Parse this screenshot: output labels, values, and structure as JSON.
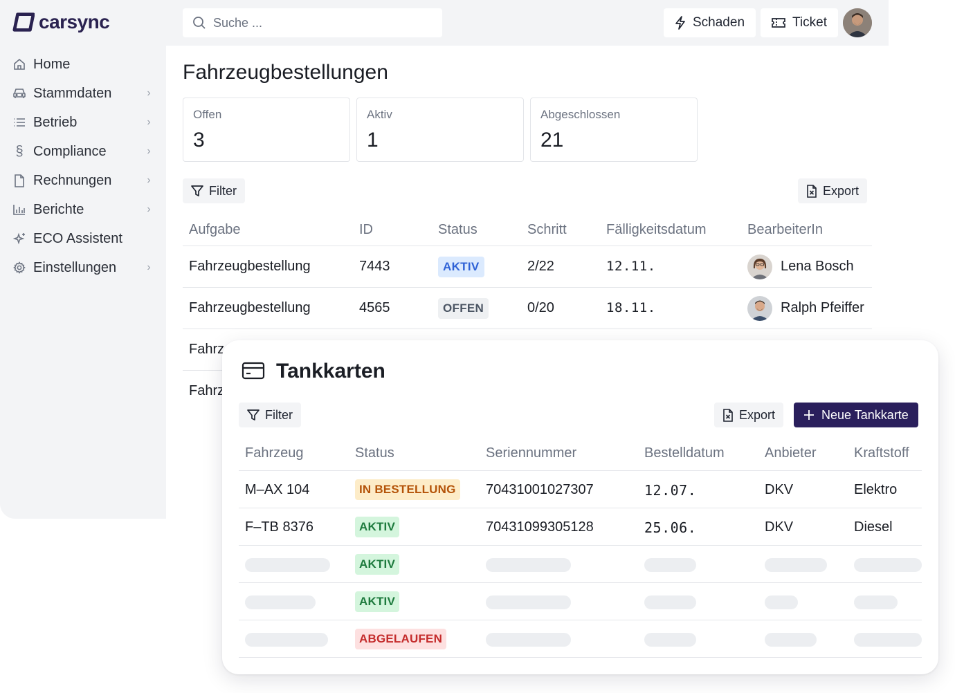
{
  "brand": {
    "name": "carsync",
    "color": "#2a2250"
  },
  "sidebar": {
    "items": [
      {
        "label": "Home",
        "icon": "home-icon",
        "chevron": false
      },
      {
        "label": "Stammdaten",
        "icon": "car-icon",
        "chevron": true
      },
      {
        "label": "Betrieb",
        "icon": "list-icon",
        "chevron": true
      },
      {
        "label": "Compliance",
        "icon": "section-icon",
        "chevron": true
      },
      {
        "label": "Rechnungen",
        "icon": "file-icon",
        "chevron": true
      },
      {
        "label": "Berichte",
        "icon": "bar-chart-icon",
        "chevron": true
      },
      {
        "label": "ECO Assistent",
        "icon": "sparkles-icon",
        "chevron": false
      },
      {
        "label": "Einstellungen",
        "icon": "gear-icon",
        "chevron": true
      }
    ]
  },
  "topbar": {
    "search_placeholder": "Suche ...",
    "damage_label": "Schaden",
    "ticket_label": "Ticket"
  },
  "main": {
    "title": "Fahrzeugbestellungen",
    "stats": [
      {
        "label": "Offen",
        "value": "3"
      },
      {
        "label": "Aktiv",
        "value": "1"
      },
      {
        "label": "Abgeschlossen",
        "value": "21"
      }
    ],
    "filter_label": "Filter",
    "export_label": "Export",
    "table": {
      "columns": [
        "Aufgabe",
        "ID",
        "Status",
        "Schritt",
        "Fälligkeitsdatum",
        "BearbeiterIn"
      ],
      "rows": [
        {
          "task": "Fahrzeugbestellung",
          "id": "7443",
          "status": "AKTIV",
          "step": "2/22",
          "due": "12.11.",
          "assignee": "Lena Bosch"
        },
        {
          "task": "Fahrzeugbestellung",
          "id": "4565",
          "status": "OFFEN",
          "step": "0/20",
          "due": "18.11.",
          "assignee": "Ralph Pfeiffer"
        },
        {
          "task": "Fahrz"
        },
        {
          "task": "Fahrz"
        }
      ]
    }
  },
  "card": {
    "title": "Tankkarten",
    "filter_label": "Filter",
    "export_label": "Export",
    "new_label": "Neue Tankkarte",
    "columns": [
      "Fahrzeug",
      "Status",
      "Seriennummer",
      "Bestelldatum",
      "Anbieter",
      "Kraftstoff"
    ],
    "rows": [
      {
        "vehicle": "M–AX 104",
        "status": "IN BESTELLUNG",
        "serial": "70431001027307",
        "date": "12.07.",
        "provider": "DKV",
        "fuel": "Elektro"
      },
      {
        "vehicle": "F–TB 8376",
        "status": "AKTIV",
        "serial": "70431099305128",
        "date": "25.06.",
        "provider": "DKV",
        "fuel": "Diesel"
      },
      {
        "status": "AKTIV"
      },
      {
        "status": "AKTIV"
      },
      {
        "status": "ABGELAUFEN"
      }
    ]
  },
  "colors": {
    "primary": "#2a1f5c",
    "status_active": "#2f62d6",
    "status_green": "#1d7a3d",
    "status_orange": "#b45309",
    "status_red": "#c42b2b"
  }
}
